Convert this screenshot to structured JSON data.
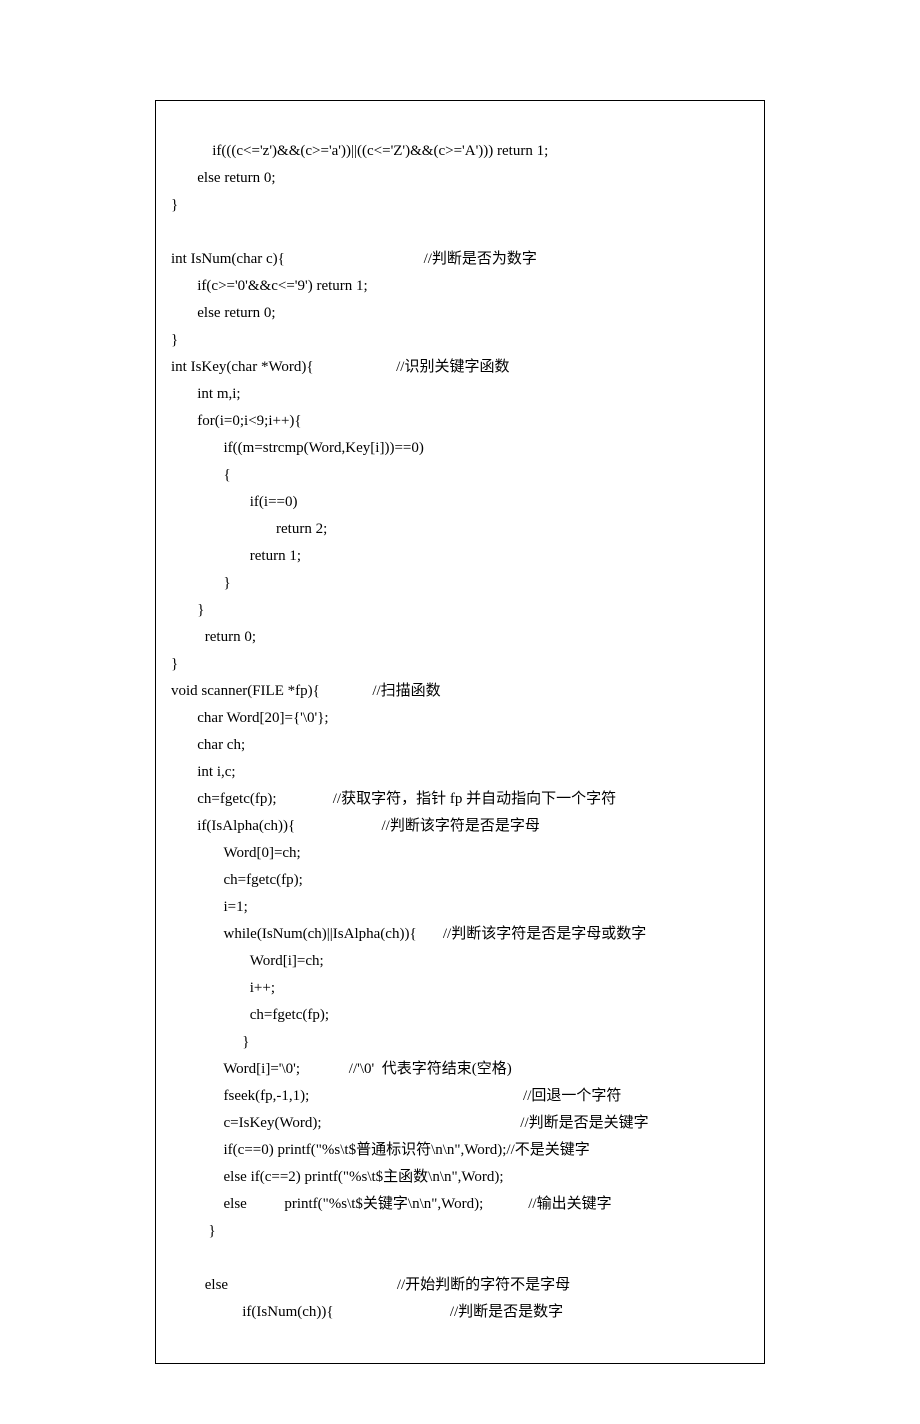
{
  "code": {
    "lines": [
      "       if(((c<='z')&&(c>='a'))||((c<='Z')&&(c>='A'))) return 1;",
      "       else return 0;",
      "}",
      "",
      "int IsNum(char c){                                     //判断是否为数字",
      "       if(c>='0'&&c<='9') return 1;",
      "       else return 0;",
      "}",
      "int IsKey(char *Word){                      //识别关键字函数",
      "       int m,i;",
      "       for(i=0;i<9;i++){",
      "              if((m=strcmp(Word,Key[i]))==0)",
      "              {",
      "                     if(i==0)",
      "                            return 2;",
      "                     return 1;",
      "              }",
      "       }",
      "         return 0;",
      "}",
      "void scanner(FILE *fp){              //扫描函数",
      "       char Word[20]={'\\0'};",
      "       char ch;",
      "       int i,c;",
      "       ch=fgetc(fp);               //获取字符，指针 fp 并自动指向下一个字符",
      "       if(IsAlpha(ch)){                       //判断该字符是否是字母",
      "              Word[0]=ch;",
      "              ch=fgetc(fp);",
      "              i=1;",
      "              while(IsNum(ch)||IsAlpha(ch)){       //判断该字符是否是字母或数字",
      "                     Word[i]=ch;",
      "                     i++;",
      "                     ch=fgetc(fp);",
      "                   }",
      "              Word[i]='\\0';             //'\\0'  代表字符结束(空格)",
      "              fseek(fp,-1,1);                                                         //回退一个字符",
      "              c=IsKey(Word);                                                     //判断是否是关键字",
      "              if(c==0) printf(\"%s\\t$普通标识符\\n\\n\",Word);//不是关键字",
      "              else if(c==2) printf(\"%s\\t$主函数\\n\\n\",Word);",
      "              else          printf(\"%s\\t$关键字\\n\\n\",Word);            //输出关键字",
      "          }",
      "",
      "         else                                             //开始判断的字符不是字母",
      "                   if(IsNum(ch)){                               //判断是否是数字"
    ]
  }
}
